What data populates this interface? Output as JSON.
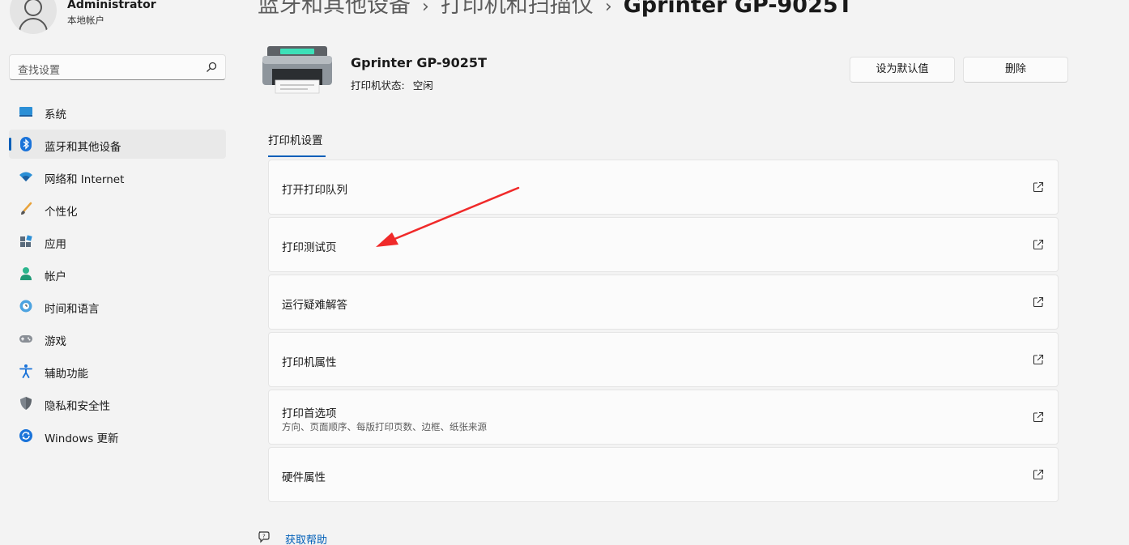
{
  "user": {
    "name": "Administrator",
    "account_type": "本地帐户"
  },
  "search": {
    "placeholder": "查找设置"
  },
  "nav": {
    "items": [
      {
        "label": "系统"
      },
      {
        "label": "蓝牙和其他设备",
        "active": true
      },
      {
        "label": "网络和 Internet"
      },
      {
        "label": "个性化"
      },
      {
        "label": "应用"
      },
      {
        "label": "帐户"
      },
      {
        "label": "时间和语言"
      },
      {
        "label": "游戏"
      },
      {
        "label": "辅助功能"
      },
      {
        "label": "隐私和安全性"
      },
      {
        "label": "Windows 更新"
      }
    ]
  },
  "breadcrumb": {
    "part1": "蓝牙和其他设备",
    "part2": "打印机和扫描仪",
    "current": "Gprinter GP-9025T",
    "separator": "›"
  },
  "printer": {
    "name": "Gprinter GP-9025T",
    "status_label": "打印机状态:",
    "status_value": "空闲"
  },
  "buttons": {
    "set_default": "设为默认值",
    "delete": "删除"
  },
  "tab": {
    "label": "打印机设置"
  },
  "cards": [
    {
      "title": "打开打印队列"
    },
    {
      "title": "打印测试页"
    },
    {
      "title": "运行疑难解答"
    },
    {
      "title": "打印机属性"
    },
    {
      "title": "打印首选项",
      "subtitle": "方向、页面顺序、每版打印页数、边框、纸张来源"
    },
    {
      "title": "硬件属性"
    }
  ],
  "help": {
    "label": "获取帮助"
  },
  "colors": {
    "accent": "#005fb8",
    "annotation_arrow": "#f02a2a"
  }
}
